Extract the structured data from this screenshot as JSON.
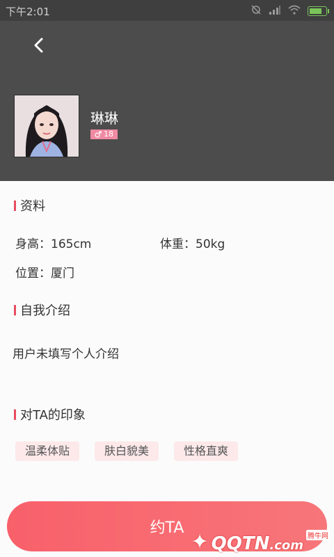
{
  "status_bar": {
    "time": "下午2:01",
    "battery_level": 0.8
  },
  "header": {
    "back_icon": "chevron-left-icon",
    "profile": {
      "name": "琳琳",
      "age": "18",
      "gender_icon": "male-symbol"
    }
  },
  "sections": {
    "info": {
      "title": "资料",
      "height": "身高：165cm",
      "weight": "体重：50kg",
      "location": "位置：厦门"
    },
    "intro": {
      "title": "自我介绍",
      "text": "用户未填写个人介绍"
    },
    "impressions": {
      "title": "对TA的印象",
      "tags": [
        "温柔体贴",
        "肤白貌美",
        "性格直爽"
      ]
    }
  },
  "cta": {
    "label": "约TA"
  },
  "watermark": {
    "brand": "QQTN",
    "domain": ".com",
    "sub": "腾牛网"
  },
  "colors": {
    "accent": "#e94b5f",
    "header_bg": "#4c4c4c",
    "badge": "#f08aa3",
    "tag_bg": "#fde9ea",
    "cta": "#f8606a"
  }
}
